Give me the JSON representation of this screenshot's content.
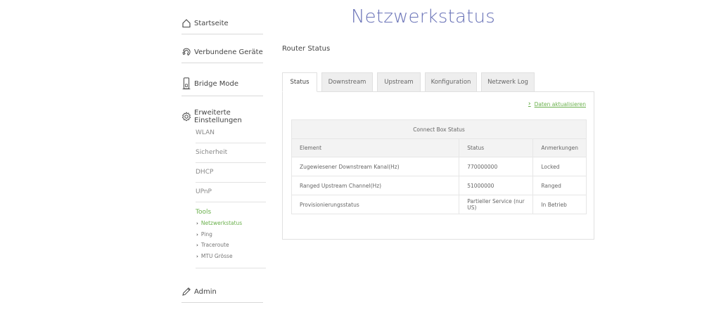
{
  "page_title": "Netzwerkstatus",
  "section_label": "Router Status",
  "sidebar": {
    "items": [
      {
        "label": "Startseite",
        "icon": "home-icon"
      },
      {
        "label": "Verbundene Geräte",
        "icon": "devices-icon"
      },
      {
        "label": "Bridge Mode",
        "icon": "router-icon"
      },
      {
        "label": "Erweiterte Einstellungen",
        "icon": "gear-icon"
      }
    ],
    "sub_items": [
      "WLAN",
      "Sicherheit",
      "DHCP",
      "UPnP"
    ],
    "tools_label": "Tools",
    "tools_items": [
      "Netzwerkstatus",
      "Ping",
      "Traceroute",
      "MTU Grösse"
    ],
    "admin": {
      "label": "Admin",
      "icon": "pencil-icon"
    }
  },
  "tabs": [
    "Status",
    "Downstream",
    "Upstream",
    "Konfiguration",
    "Netzwerk Log"
  ],
  "active_tab": "Status",
  "refresh_link": "Daten aktualisieren",
  "table": {
    "caption": "Connect Box Status",
    "headers": [
      "Element",
      "Status",
      "Anmerkungen"
    ],
    "rows": [
      [
        "Zugewiesener Downstream Kanal(Hz)",
        "770000000",
        "Locked"
      ],
      [
        "Ranged Upstream Channel(Hz)",
        "51000000",
        "Ranged"
      ],
      [
        "Provisionierungsstatus",
        "Partieller Service (nur US)",
        "In Betrieb"
      ]
    ]
  },
  "colors": {
    "accent_green": "#6ab04c",
    "title_blue": "#6b74b8"
  }
}
